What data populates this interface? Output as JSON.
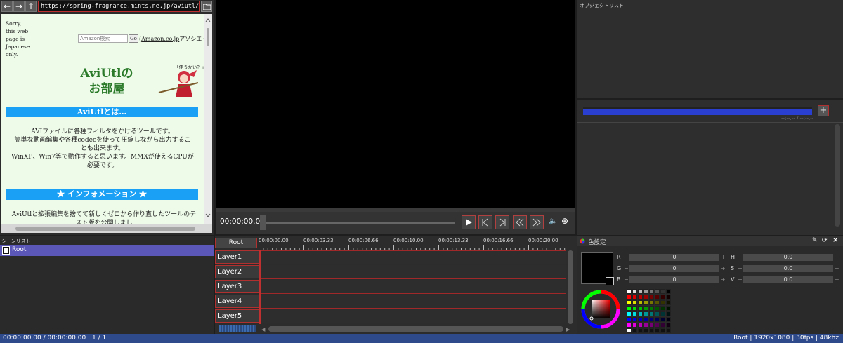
{
  "browser": {
    "url": "https://spring-fragrance.mints.ne.jp/aviutl/",
    "back_icon": "←",
    "forward_icon": "→",
    "up_icon": "↑",
    "sorry_text": [
      "Sorry,",
      "this web",
      "page is",
      "Japanese",
      "only."
    ],
    "search_placeholder": "Amazon検索",
    "go_label": "Go",
    "amazon_link": "Amazon.co.jp",
    "amazon_prefix": "(",
    "amazon_suffix": "アソシエイト)",
    "site_title_line1": "AviUtlの",
    "site_title_line2": "お部屋",
    "mascot_caption": "「使うかい？」",
    "section1_title": "AviUtlとは…",
    "section1_body": [
      "AVIファイルに各種フィルタをかけるツールです。",
      "簡単な動画編集や各種codecを使って圧縮しながら出力するこ",
      "とも出来ます。",
      "WinXP、Win7等で動作すると思います。MMXが使えるCPUが",
      "必要です。"
    ],
    "section2_title": "★ インフォメーション ★",
    "section2_body": [
      "AviUtlと拡張編集を捨てて新しくゼロから作り直したツールのテ",
      "スト版を公開しまし"
    ]
  },
  "preview": {
    "time": "00:00:00.00",
    "buttons": [
      "play",
      "step-back",
      "step-forward",
      "rewind",
      "fast-forward"
    ],
    "volume_icon": "🔈",
    "zoom_icon": "⊕"
  },
  "object_list": {
    "title": "オブジェクトリスト",
    "time_readout": "--:--.-- / --:--.--",
    "add_icon": "+"
  },
  "scene_list": {
    "title": "シーンリスト",
    "items": [
      "Root"
    ]
  },
  "timeline": {
    "root_label": "Root",
    "ticks": [
      "00:00:00.00",
      "00:00:03.33",
      "00:00:06.66",
      "00:00:10.00",
      "00:00:13.33",
      "00:00:16.66",
      "00:00:20.00"
    ],
    "layers": [
      "Layer1",
      "Layer2",
      "Layer3",
      "Layer4",
      "Layer5"
    ]
  },
  "color_settings": {
    "title": "色設定",
    "rgb": [
      {
        "label": "R",
        "value": "0"
      },
      {
        "label": "G",
        "value": "0"
      },
      {
        "label": "B",
        "value": "0"
      }
    ],
    "hsv": [
      {
        "label": "H",
        "value": "0.0"
      },
      {
        "label": "S",
        "value": "0.0"
      },
      {
        "label": "V",
        "value": "0.0"
      }
    ],
    "minus": "−",
    "plus": "+"
  },
  "status_bar": {
    "left": "00:00:00.00 / 00:00:00.00 | 1 / 1",
    "right": "Root | 1920x1080 | 30fps | 48khz"
  },
  "colors": {
    "accent_red": "#b03030",
    "selection_blue": "#5b57b8",
    "progress_blue": "#2a3fd0",
    "status_blue": "#2f4a8a",
    "site_blue": "#1aa0f5",
    "site_green_title": "#2a7a2a"
  }
}
